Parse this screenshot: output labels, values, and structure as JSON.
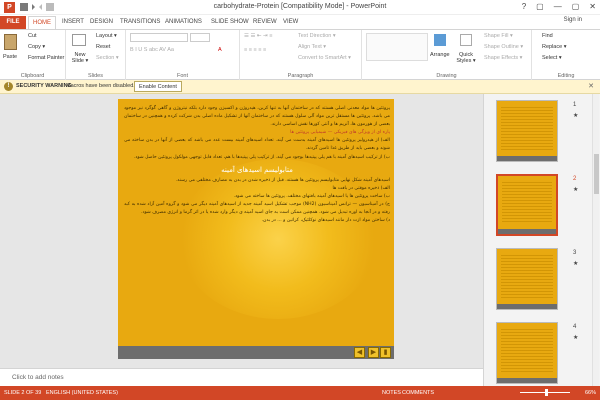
{
  "window": {
    "app_icon": "P",
    "title": "carbohydrate-Protein [Compatibility Mode] - PowerPoint",
    "controls": [
      "?",
      "▢",
      "—",
      "▢",
      "✕"
    ]
  },
  "account": {
    "signin": "Sign in"
  },
  "tabs": [
    "FILE",
    "HOME",
    "INSERT",
    "DESIGN",
    "TRANSITIONS",
    "ANIMATIONS",
    "SLIDE SHOW",
    "REVIEW",
    "VIEW"
  ],
  "ribbon": {
    "clipboard": {
      "label": "Clipboard",
      "paste": "Paste",
      "cut": "Cut",
      "copy": "Copy ▾",
      "format_painter": "Format Painter"
    },
    "slides": {
      "label": "Slides",
      "new_slide": "New Slide ▾",
      "layout": "Layout ▾",
      "reset": "Reset",
      "section": "Section ▾"
    },
    "font": {
      "label": "Font"
    },
    "paragraph": {
      "label": "Paragraph",
      "text_direction": "Text Direction ▾",
      "align_text": "Align Text ▾",
      "convert": "Convert to SmartArt ▾"
    },
    "drawing": {
      "label": "Drawing",
      "arrange": "Arrange",
      "quick_styles": "Quick Styles ▾",
      "shape_fill": "Shape Fill ▾",
      "shape_outline": "Shape Outline ▾",
      "shape_effects": "Shape Effects ▾"
    },
    "editing": {
      "label": "Editing",
      "find": "Find",
      "replace": "Replace ▾",
      "select": "Select ▾"
    }
  },
  "security_bar": {
    "icon": "!",
    "title": "SECURITY WARNING",
    "message": "Macros have been disabled.",
    "button": "Enable Content",
    "close": "✕"
  },
  "slide": {
    "paragraph1": "پروتئین ها مواد معدنی اصلی هستند که در ساختمان آنها به تنها کربن، هیدروژن و اکسیژن وجود دارد بلکه نیتروژن و گاهی گوگرد نیز موجود می باشد. پروتئین ها مستقل ترین مواد آلی سلول هستند که در ساختمان آنها از تشکیل ماده اصلی بدن شرکت کرده و همچنین در ساختمان بعضی از هورمون ها، آنزیم ها و آنتی کورها نقش اساسی دارند.",
    "subtitle": "پاره ای از ویژگی های فیزیکی — شیمیایی پروتئین ها",
    "paragraph2": "الف) از هیدرولیز پروتئین ها اسیدهای آمینه بدست می آیند. تعداد اسیدهای آمینه بیست عدد می باشد که بعضی از آنها در بدن ساخته می شوند و بعضی باید از طریق غذا تامین گردند.",
    "paragraph3": "ب) از ترکیب اسیدهای آمینه با هم پلی پپتیدها بوجود می آیند. از ترکیب پلی پپتیدها با هم، تعداد قابل توجهی مولکول پروتئین حاصل شود.",
    "heading": "متابولیسم اسیدهای آمینه",
    "paragraph4": "اسیدهای آمینه شکل نهایی متابولیسم پروتئین ها هستند. قبل از ذخیره شدن در بدن به مصارف مختلفی می رسند.",
    "paragraph5": "الف) ذخیره موقتی در بافت ها",
    "paragraph6": "ب) ساخت پروتئین ها یا اسیدهای آمینه بافتهای مختلف. پروتئین ها ساخته می شود.",
    "paragraph7": "ج) در آمیناسیون — ترانس آمیناسیون (NH2) موجب تشکیل اسید آمینه جدید از اسیدهای آمینه دیگر می شود و گروه آمین آزاد شده به کبد رفته و در آنجا به اوره تبدیل می شود. همچنین ممکن است به جای اسید آمینه ی دیگر وارد شده یا در اثر گرما و انرژی مصرف شود.",
    "paragraph8": "د) ساختن مواد ازت دار مانند اسیدهای نوکلئیک، کراتین و ... در بدن."
  },
  "notes": {
    "placeholder": "Click to add notes"
  },
  "thumbnails": [
    {
      "num": "1",
      "star": "★"
    },
    {
      "num": "2",
      "star": "★"
    },
    {
      "num": "3",
      "star": "★"
    },
    {
      "num": "4",
      "star": "★"
    }
  ],
  "status": {
    "slide": "SLIDE 2 OF 39",
    "language": "ENGLISH (UNITED STATES)",
    "notes": "NOTES",
    "comments": "COMMENTS",
    "zoom": "66%"
  }
}
